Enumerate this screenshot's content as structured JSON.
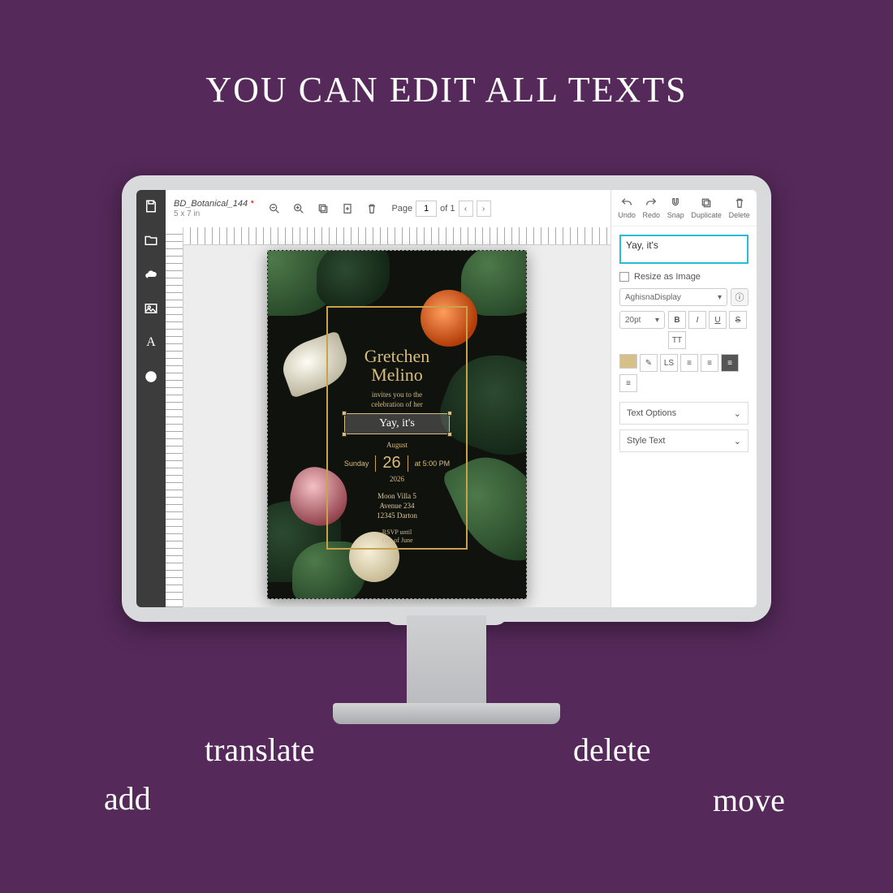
{
  "headline": "YOU CAN EDIT ALL TEXTS",
  "doc": {
    "name": "BD_Botanical_144",
    "modified_marker": "*",
    "size": "5 x 7 in"
  },
  "toolbar": {
    "page_label": "Page",
    "page_current": "1",
    "page_of": "of 1"
  },
  "sidebar_icons": [
    "save",
    "open",
    "cloud",
    "image",
    "text",
    "info"
  ],
  "card": {
    "name_line1": "Gretchen",
    "name_line2": "Melino",
    "invite_line1": "invites you to the",
    "invite_line2": "celebration of her",
    "selected_text": "Yay, it's",
    "month": "August",
    "weekday": "Sunday",
    "day": "26",
    "time": "at 5:00 PM",
    "year": "2026",
    "addr1": "Moon Villa 5",
    "addr2": "Avenue 234",
    "addr3": "12345 Darton",
    "rsvp1": "RSVP until",
    "rsvp2": "11th of June"
  },
  "props": {
    "actions": {
      "undo": "Undo",
      "redo": "Redo",
      "snap": "Snap",
      "duplicate": "Duplicate",
      "delete": "Delete"
    },
    "text_value": "Yay, it's",
    "resize_label": "Resize as Image",
    "font_name": "AghisnaDisplay",
    "font_size": "20pt",
    "fmt": {
      "bold": "B",
      "italic": "I",
      "underline": "U",
      "strike": "S",
      "caps": "TT",
      "ls": "LS"
    },
    "swatch_color": "#d6c08a",
    "acc_text_options": "Text Options",
    "acc_style_text": "Style Text"
  },
  "callouts": {
    "add": "add",
    "translate": "translate",
    "delete": "delete",
    "move": "move"
  }
}
